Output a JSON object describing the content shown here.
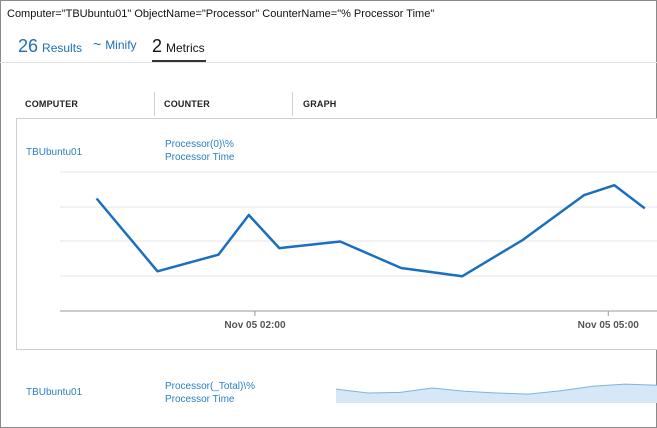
{
  "query": {
    "text": "Computer=\"TBUbuntu01\" ObjectName=\"Processor\" CounterName=\"% Processor Time\""
  },
  "tabs": {
    "results": {
      "count": "26",
      "label": "Results"
    },
    "minify": {
      "symbol": "~",
      "label": "Minify"
    },
    "metrics": {
      "count": "2",
      "label": "Metrics"
    }
  },
  "columns": {
    "computer": "COMPUTER",
    "counter": "COUNTER",
    "graph": "GRAPH"
  },
  "rows": [
    {
      "computer": "TBUbuntu01",
      "counter_line1": "Processor(0)\\%",
      "counter_line2": "Processor Time"
    },
    {
      "computer": "TBUbuntu01",
      "counter_line1": "Processor(_Total)\\%",
      "counter_line2": "Processor Time"
    }
  ],
  "colors": {
    "accent": "#1f6fb5",
    "line": "#1a6fbf",
    "spark_fill": "#d6e7f7",
    "spark_line": "#7fb3e0",
    "grid": "#e6e6e6"
  },
  "chart_data": [
    {
      "type": "line",
      "series": [
        {
          "values": [
            3.4,
            1.2,
            1.7,
            2.9,
            1.9,
            2.1,
            1.3,
            1.05,
            2.15,
            3.5,
            3.8,
            3.1
          ]
        }
      ],
      "x": [
        0,
        1,
        2,
        2.5,
        3,
        4,
        5,
        6,
        7,
        8,
        8.5,
        9
      ],
      "xtick_labels": [
        "Nov 05 02:00",
        "Nov 05 05:00"
      ],
      "xtick_positions": [
        2.6,
        8.4
      ],
      "ylim": [
        0,
        4.2
      ],
      "xlim": [
        -0.6,
        9.2
      ],
      "grid": true,
      "legend": "none"
    },
    {
      "type": "area",
      "series": [
        {
          "values": [
            2.5,
            1.8,
            1.9,
            2.7,
            2.1,
            1.8,
            1.6,
            2.2,
            3.0,
            3.4,
            3.2
          ]
        }
      ],
      "ylim": [
        0,
        4.5
      ],
      "grid": false,
      "legend": "none"
    }
  ]
}
